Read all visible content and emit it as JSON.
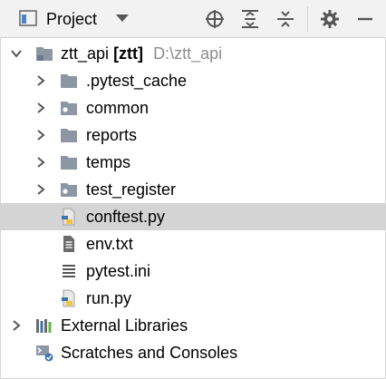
{
  "toolbar": {
    "title": "Project",
    "panel_icon": "project-panel-icon",
    "buttons": [
      "locate-icon",
      "expand-all-icon",
      "collapse-all-icon",
      "settings-gear-icon",
      "hide-minus-icon"
    ]
  },
  "tree": {
    "root": {
      "name": "ztt_api",
      "module": "[ztt]",
      "path": "D:\\ztt_api"
    },
    "items": [
      {
        "label": ".pytest_cache"
      },
      {
        "label": "common"
      },
      {
        "label": "reports"
      },
      {
        "label": "temps"
      },
      {
        "label": "test_register"
      },
      {
        "label": "conftest.py"
      },
      {
        "label": "env.txt"
      },
      {
        "label": "pytest.ini"
      },
      {
        "label": "run.py"
      }
    ],
    "external_libraries": "External Libraries",
    "scratches": "Scratches and Consoles"
  },
  "colors": {
    "toolbar_bg": "#f2f2f2",
    "selection": "#d4d4d4",
    "folder": "#8d97a3",
    "python_blue": "#3b74ad",
    "python_yellow": "#f2c43b"
  }
}
